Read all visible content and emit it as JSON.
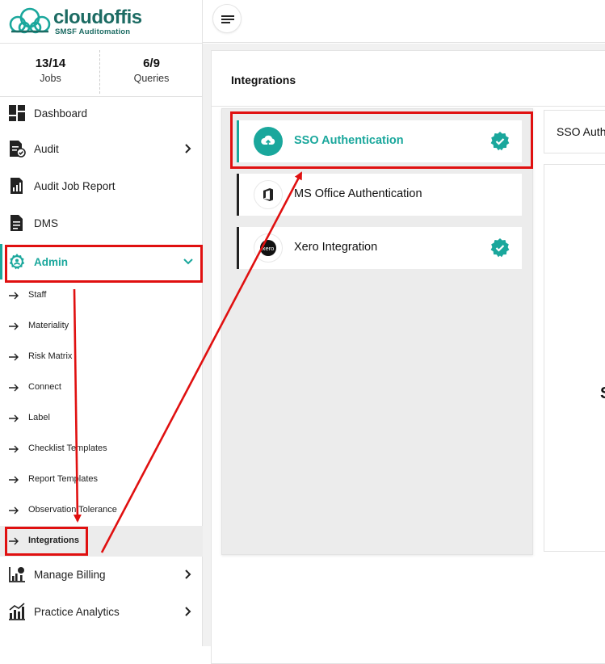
{
  "brand": {
    "name": "cloudoffis",
    "tagline": "SMSF Auditomation",
    "color": "#1c6b63"
  },
  "stats": [
    {
      "value": "13/14",
      "label": "Jobs"
    },
    {
      "value": "6/9",
      "label": "Queries"
    }
  ],
  "sidebar": {
    "items": [
      {
        "label": "Dashboard",
        "icon": "dashboard-icon"
      },
      {
        "label": "Audit",
        "icon": "audit-icon",
        "has_chevron": true
      },
      {
        "label": "Audit Job Report",
        "icon": "report-icon"
      },
      {
        "label": "DMS",
        "icon": "document-icon"
      },
      {
        "label": "Admin",
        "icon": "admin-icon",
        "expanded": true,
        "active": true
      }
    ],
    "admin_subitems": [
      {
        "label": "Staff"
      },
      {
        "label": "Materiality"
      },
      {
        "label": "Risk Matrix"
      },
      {
        "label": "Connect"
      },
      {
        "label": "Label"
      },
      {
        "label": "Checklist Templates"
      },
      {
        "label": "Report Templates"
      },
      {
        "label": "Observation Tolerance"
      },
      {
        "label": "Integrations",
        "active": true
      }
    ],
    "bottom_items": [
      {
        "label": "Manage Billing",
        "icon": "billing-icon",
        "has_chevron": true
      },
      {
        "label": "Practice Analytics",
        "icon": "analytics-icon",
        "has_chevron": true
      }
    ]
  },
  "main": {
    "title": "Integrations",
    "integrations": [
      {
        "label": "SSO Authentication",
        "icon": "cloud-upload-icon",
        "verified": true,
        "active": true
      },
      {
        "label": "MS Office Authentication",
        "icon": "office-icon",
        "verified": false
      },
      {
        "label": "Xero Integration",
        "icon": "xero-icon",
        "verified": true
      }
    ],
    "detail_title": "SSO Auth",
    "detail_body_char": "S"
  },
  "colors": {
    "accent": "#1aa79c",
    "annotation": "#e01010"
  }
}
